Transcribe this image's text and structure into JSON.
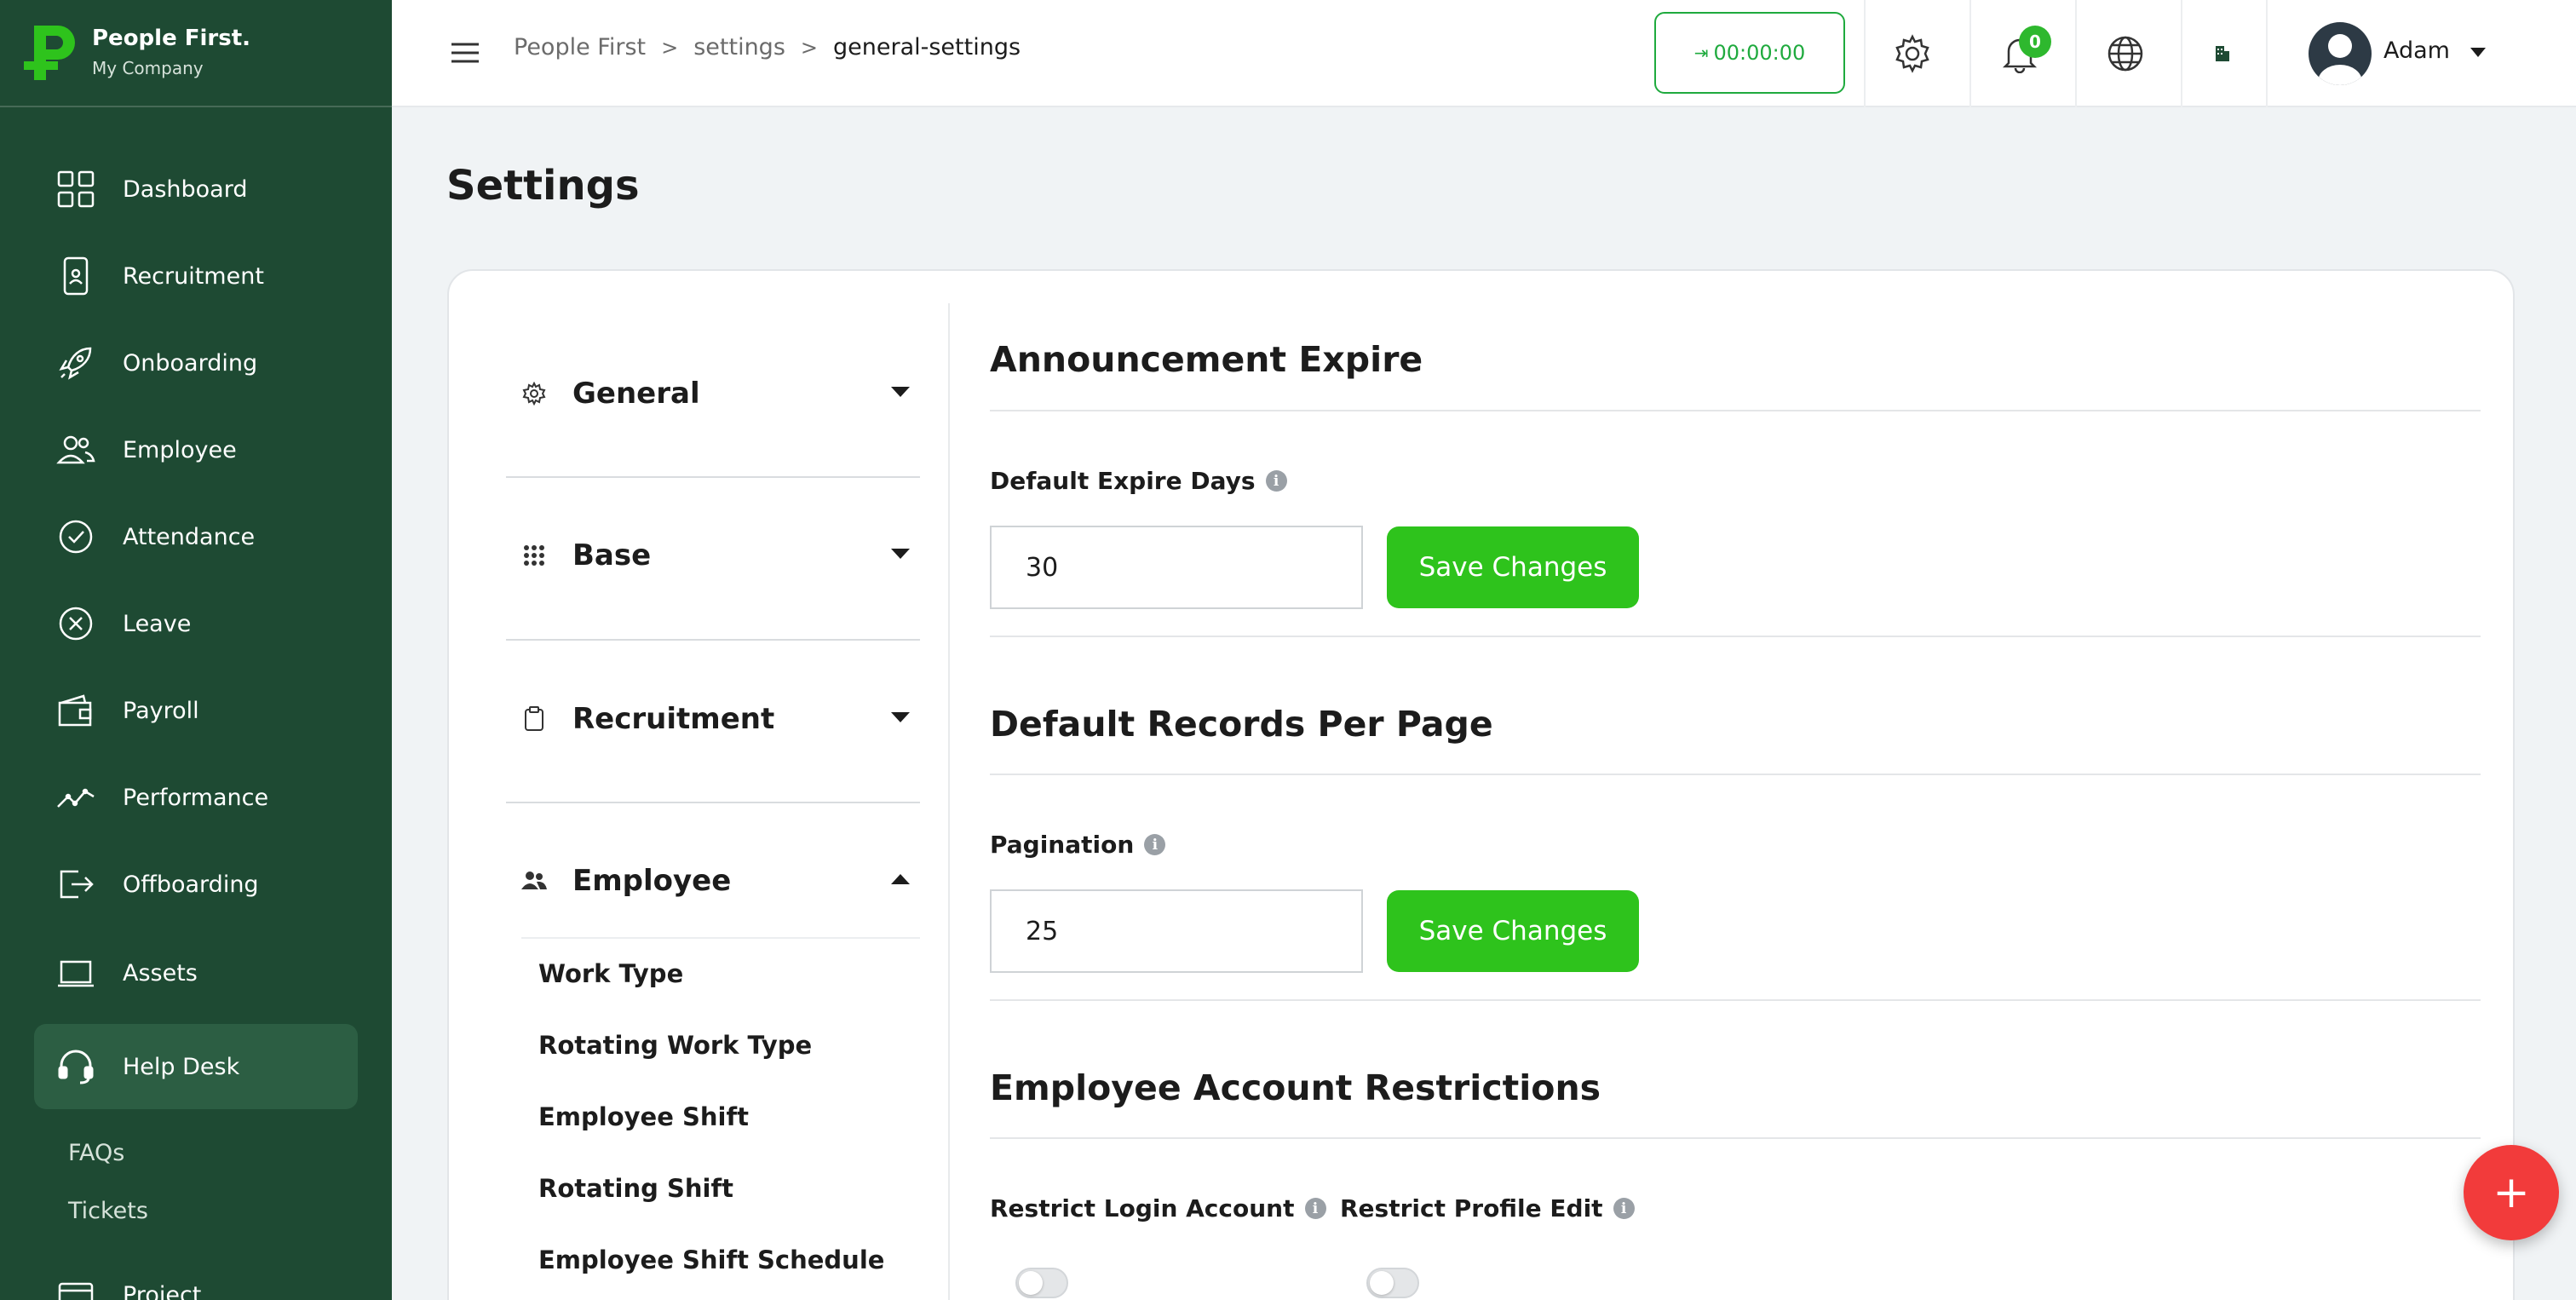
{
  "brand": {
    "name": "People First.",
    "company": "My Company"
  },
  "sidebar": {
    "items": [
      {
        "label": "Dashboard",
        "icon": "dashboard-icon"
      },
      {
        "label": "Recruitment",
        "icon": "recruitment-icon"
      },
      {
        "label": "Onboarding",
        "icon": "rocket-icon"
      },
      {
        "label": "Employee",
        "icon": "users-icon"
      },
      {
        "label": "Attendance",
        "icon": "check-circle-icon"
      },
      {
        "label": "Leave",
        "icon": "x-circle-icon"
      },
      {
        "label": "Payroll",
        "icon": "wallet-icon"
      },
      {
        "label": "Performance",
        "icon": "trend-icon"
      },
      {
        "label": "Offboarding",
        "icon": "exit-icon"
      },
      {
        "label": "Assets",
        "icon": "laptop-icon"
      },
      {
        "label": "Help Desk",
        "icon": "headset-icon",
        "active": true
      }
    ],
    "subitems": [
      "FAQs",
      "Tickets"
    ],
    "partial_item": "Project"
  },
  "header": {
    "breadcrumb": [
      "People First",
      "settings",
      "general-settings"
    ],
    "timer": "00:00:00",
    "notification_count": "0",
    "user_name": "Adam"
  },
  "page": {
    "title": "Settings"
  },
  "settings_nav": {
    "groups": [
      {
        "label": "General",
        "icon": "gear-icon",
        "expanded": false
      },
      {
        "label": "Base",
        "icon": "grid-dots-icon",
        "expanded": false
      },
      {
        "label": "Recruitment",
        "icon": "clipboard-icon",
        "expanded": false
      },
      {
        "label": "Employee",
        "icon": "people-icon",
        "expanded": true
      }
    ],
    "employee_items": [
      "Work Type",
      "Rotating Work Type",
      "Employee Shift",
      "Rotating Shift",
      "Employee Shift Schedule"
    ]
  },
  "sections": {
    "announcement": {
      "title": "Announcement Expire",
      "field_label": "Default Expire Days",
      "value": "30",
      "button": "Save Changes"
    },
    "records": {
      "title": "Default Records Per Page",
      "field_label": "Pagination",
      "value": "25",
      "button": "Save Changes"
    },
    "restrictions": {
      "title": "Employee Account Restrictions",
      "login_label": "Restrict Login Account",
      "profile_label": "Restrict Profile Edit",
      "login_enabled": false,
      "profile_enabled": false
    }
  },
  "fab": {
    "label": "+"
  },
  "colors": {
    "sidebar": "#1e4a33",
    "accent_green": "#2ec31c",
    "fab_red": "#f23b3b",
    "timer_green": "#1faa3e"
  }
}
